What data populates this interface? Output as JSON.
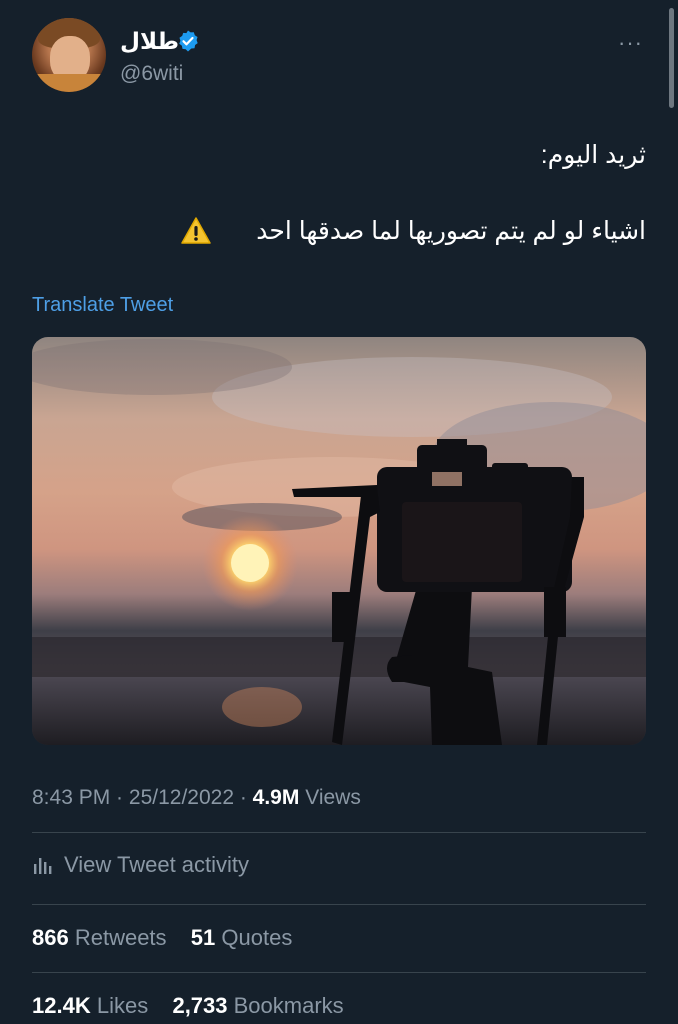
{
  "author": {
    "name": "طلال",
    "handle": "@6witi",
    "verified": true
  },
  "more_menu": "···",
  "tweet": {
    "line1": "ثريد اليوم:",
    "line2": "اشياء لو لم يتم تصوريها لما صدقها احد",
    "line2_emoji_icon": "warning-icon",
    "translate_label": "Translate Tweet"
  },
  "meta": {
    "time": "8:43 PM",
    "sep1": " · ",
    "date": "25/12/2022",
    "sep2": " · ",
    "views_count": "4.9M",
    "views_label": " Views"
  },
  "activity": {
    "icon": "chart-bars-icon",
    "label": "View Tweet activity"
  },
  "stats": {
    "retweets_count": "866",
    "retweets_label": " Retweets",
    "quotes_count": "51",
    "quotes_label": " Quotes",
    "likes_count": "12.4K",
    "likes_label": " Likes",
    "bookmarks_count": "2,733",
    "bookmarks_label": " Bookmarks"
  },
  "colors": {
    "background": "#15202b",
    "link": "#4e9fe6",
    "secondary_text": "#8b98a5",
    "divider": "#38444d",
    "verified": "#1d9bf0"
  }
}
